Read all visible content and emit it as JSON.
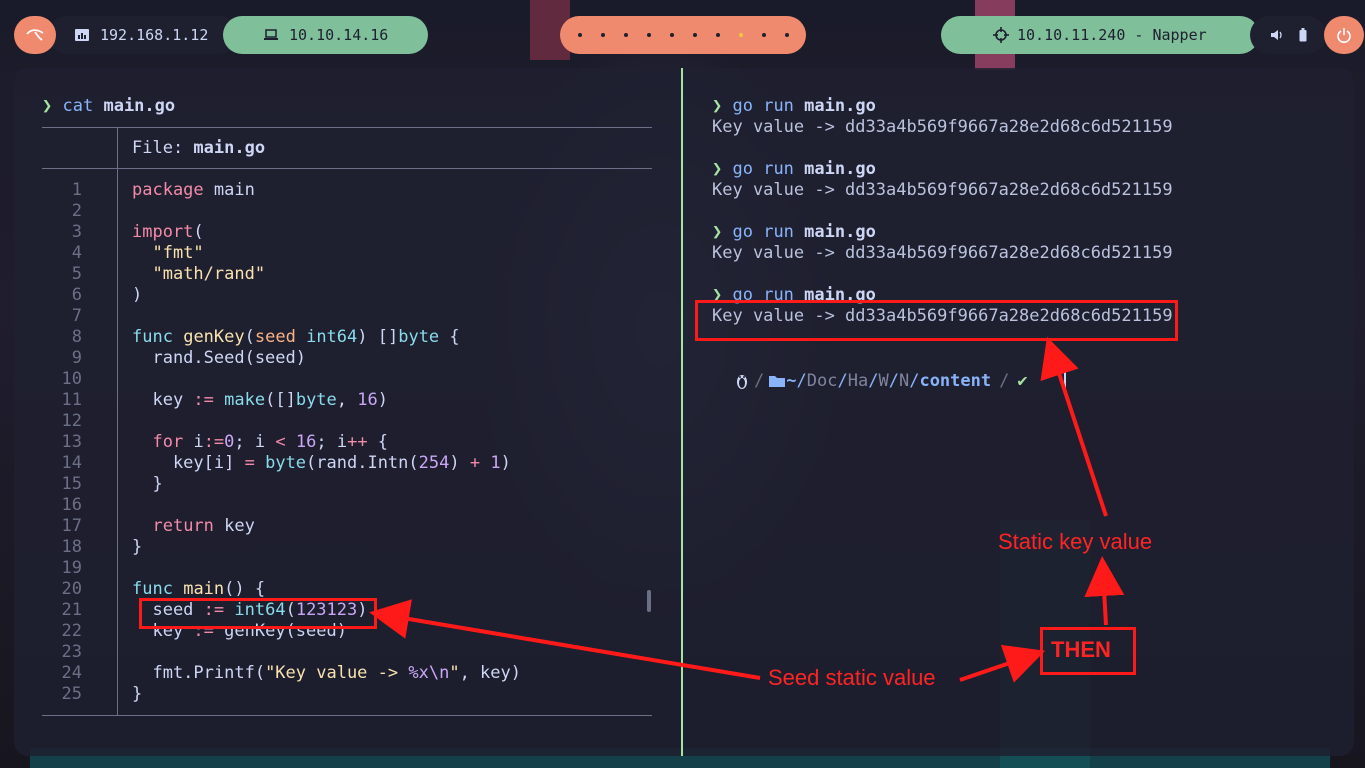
{
  "topbar": {
    "local_ip": "192.168.1.12",
    "vpn_ip": "10.10.14.16",
    "target": "10.10.11.240 - Napper",
    "workspaces_count": 10,
    "active_workspace": 8,
    "icons": {
      "os": "kali-dragon-icon",
      "local": "network-icon",
      "vpn": "laptop-icon",
      "target": "crosshair-icon",
      "volume": "speaker-icon",
      "battery": "battery-icon",
      "power": "power-icon"
    }
  },
  "left_pane": {
    "prompt_symbol": "❯",
    "command": "cat",
    "argument": "main.go",
    "file_prefix": "File: ",
    "file_name": "main.go",
    "line_numbers": [
      "1",
      "2",
      "3",
      "4",
      "5",
      "6",
      "7",
      "8",
      "9",
      "10",
      "11",
      "12",
      "13",
      "14",
      "15",
      "16",
      "17",
      "18",
      "19",
      "20",
      "21",
      "22",
      "23",
      "24",
      "25"
    ]
  },
  "right_pane": {
    "runs": [
      {
        "cmd": "go run",
        "file": "main.go",
        "output": "Key value -> dd33a4b569f9667a28e2d68c6d521159"
      },
      {
        "cmd": "go run",
        "file": "main.go",
        "output": "Key value -> dd33a4b569f9667a28e2d68c6d521159"
      },
      {
        "cmd": "go run",
        "file": "main.go",
        "output": "Key value -> dd33a4b569f9667a28e2d68c6d521159"
      },
      {
        "cmd": "go run",
        "file": "main.go",
        "output": "Key value -> dd33a4b569f9667a28e2d68c6d521159"
      }
    ],
    "prompt_path": {
      "os_icon": "linux-penguin-icon",
      "folder_icon": "folder-icon",
      "home": "~",
      "segments": [
        "Doc",
        "Ha",
        "W",
        "N"
      ],
      "current": "content",
      "status": "✔"
    }
  },
  "annotations": {
    "seed_label": "Seed static value",
    "then_label": "THEN",
    "static_key_label": "Static key value"
  },
  "colors": {
    "accent_orange": "#f08a6e",
    "accent_green": "#7fbf9a",
    "annotation_red": "#ff1a1a"
  }
}
